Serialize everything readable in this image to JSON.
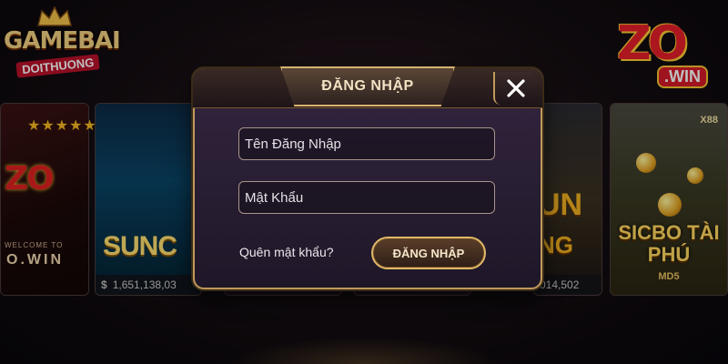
{
  "logos": {
    "left": {
      "line1": "GAMEBAI",
      "line2": "DOITHUONG",
      "stars": "★★★★★"
    },
    "right": {
      "brand": "ZO",
      "suffix": ".WIN"
    }
  },
  "lobby": {
    "cards": [
      {
        "id": "zowin",
        "welcome": "WELCOME TO",
        "name": "O.WIN"
      },
      {
        "id": "suncity",
        "title": "SUNC",
        "amount": "1,651,138,03"
      },
      {
        "id": "hidden1",
        "amount": ""
      },
      {
        "id": "hidden2",
        "amount": ""
      },
      {
        "id": "sunwin",
        "title_line1": "UN",
        "title_line2": "NG",
        "amount": "014,502"
      },
      {
        "id": "sicbo",
        "badge": "X88",
        "title": "SICBO TÀI PHÚ",
        "subtitle": "MD5"
      }
    ]
  },
  "dialog": {
    "title": "ĐĂNG NHẬP",
    "username_placeholder": "Tên Đăng Nhập",
    "password_placeholder": "Mật Khẩu",
    "forgot_label": "Quên mật khẩu?",
    "submit_label": "ĐĂNG NHẬP"
  },
  "colors": {
    "accent_gold": "#c09a5a",
    "dialog_bg": "#2b2036",
    "brand_red": "#e41e2a"
  },
  "icons": {
    "close": "close-icon",
    "dollar": "dollar-icon",
    "crown": "crown-icon"
  }
}
